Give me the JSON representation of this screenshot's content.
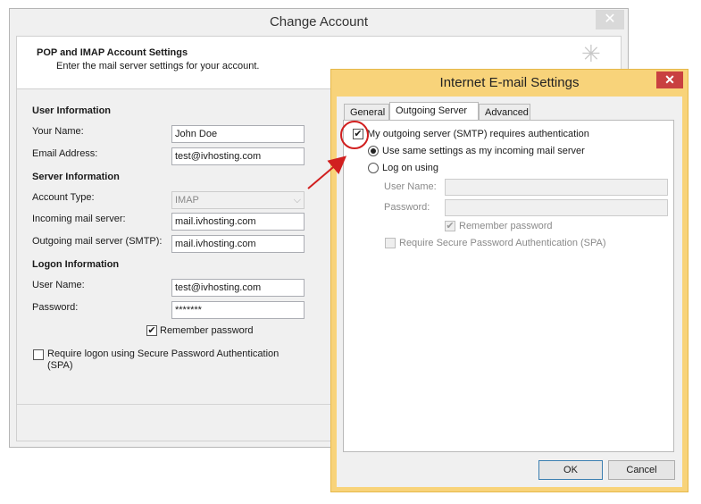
{
  "change_account": {
    "title": "Change Account",
    "close_glyph": "✕",
    "header_title": "POP and IMAP Account Settings",
    "header_subtitle": "Enter the mail server settings for your account.",
    "user_info_heading": "User Information",
    "your_name_label": "Your Name:",
    "your_name_value": "John Doe",
    "email_label": "Email Address:",
    "email_value": "test@ivhosting.com",
    "server_info_heading": "Server Information",
    "account_type_label": "Account Type:",
    "account_type_value": "IMAP",
    "incoming_label": "Incoming mail server:",
    "incoming_value": "mail.ivhosting.com",
    "outgoing_label": "Outgoing mail server (SMTP):",
    "outgoing_value": "mail.ivhosting.com",
    "logon_heading": "Logon Information",
    "username_label": "User Name:",
    "username_value": "test@ivhosting.com",
    "password_label": "Password:",
    "password_value": "*******",
    "remember_label": "Remember password",
    "spa_label_line1": "Require logon using Secure Password Authentication",
    "spa_label_line2": "(SPA)"
  },
  "internet_email": {
    "title": "Internet E-mail Settings",
    "close_glyph": "✕",
    "tabs": [
      "General",
      "Outgoing Server",
      "Advanced"
    ],
    "smtp_auth_label": "My outgoing server (SMTP) requires authentication",
    "use_same_label": "Use same settings as my incoming mail server",
    "logon_using_label": "Log on using",
    "username_label": "User Name:",
    "password_label": "Password:",
    "remember_label": "Remember password",
    "spa_label": "Require Secure Password Authentication (SPA)",
    "ok_label": "OK",
    "cancel_label": "Cancel"
  },
  "check_glyph": "✔",
  "colors": {
    "accent_frame": "#f8d37a",
    "close_red": "#c94040",
    "annotation_red": "#d11f1f"
  }
}
